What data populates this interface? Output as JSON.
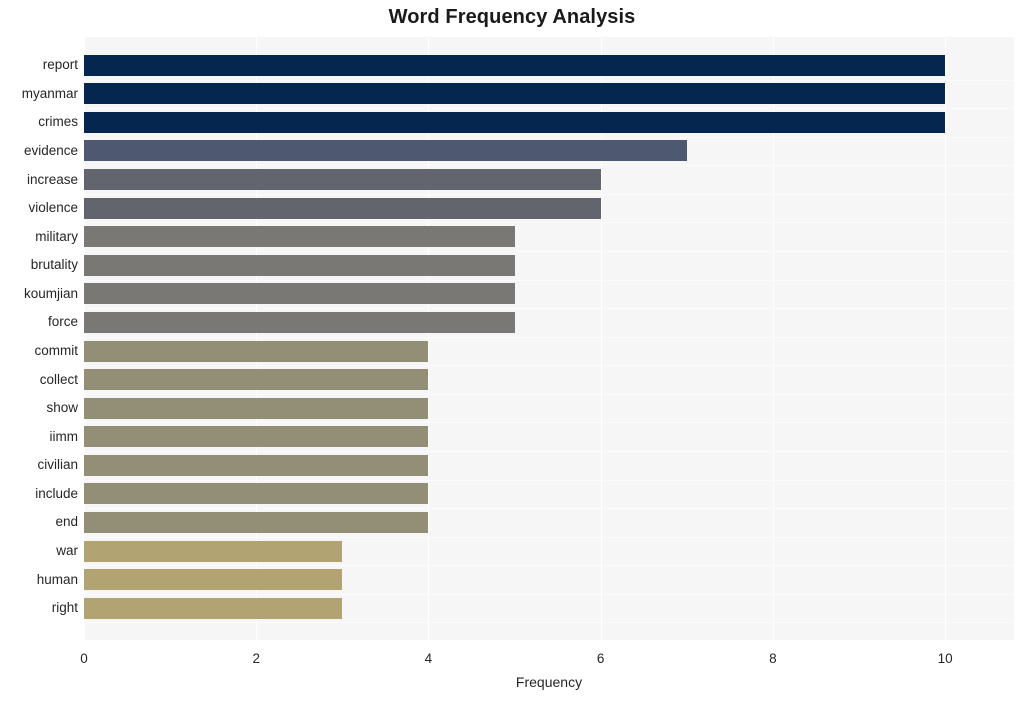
{
  "chart_data": {
    "type": "bar",
    "orientation": "horizontal",
    "title": "Word Frequency Analysis",
    "xlabel": "Frequency",
    "ylabel": "",
    "categories": [
      "report",
      "myanmar",
      "crimes",
      "evidence",
      "increase",
      "violence",
      "military",
      "brutality",
      "koumjian",
      "force",
      "commit",
      "collect",
      "show",
      "iimm",
      "civilian",
      "include",
      "end",
      "war",
      "human",
      "right"
    ],
    "values": [
      10,
      10,
      10,
      7,
      6,
      6,
      5,
      5,
      5,
      5,
      4,
      4,
      4,
      4,
      4,
      4,
      4,
      3,
      3,
      3
    ],
    "bar_colors": [
      "#04264f",
      "#04264f",
      "#04264f",
      "#4f5871",
      "#63656e",
      "#63656e",
      "#7a7874",
      "#7a7874",
      "#7a7874",
      "#7a7874",
      "#938e76",
      "#938e76",
      "#938e76",
      "#938e76",
      "#938e76",
      "#938e76",
      "#938e76",
      "#b1a472",
      "#b1a472",
      "#b1a472"
    ],
    "xlim": [
      0,
      10.8
    ],
    "xticks": [
      0,
      2,
      4,
      6,
      8,
      10
    ],
    "xtick_labels": [
      "0",
      "2",
      "4",
      "6",
      "8",
      "10"
    ],
    "grid": true,
    "grid_axis": "x",
    "legend": null,
    "plot_background": "#f6f6f6",
    "figure_background": "#ffffff",
    "gridline_color": "#ffffff"
  }
}
